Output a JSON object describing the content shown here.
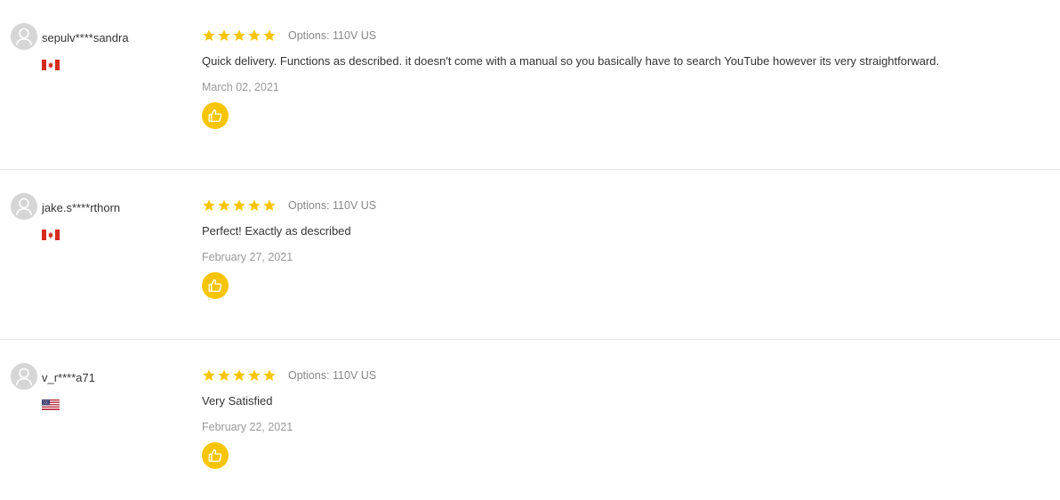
{
  "colors": {
    "star": "#f7c500",
    "like_button": "#f7c500",
    "avatar_bg": "#d6d6d6",
    "divider": "#e8e8e8",
    "meta_text": "#888888"
  },
  "icons": {
    "avatar": "default-user-icon",
    "star": "star-icon",
    "like": "thumbs-up-icon"
  },
  "reviews": [
    {
      "username": "sepulv****sandra",
      "country_flag": "canada-flag-icon",
      "rating_stars": 5,
      "options": "Options: 110V US",
      "comment": "Quick delivery. Functions as described. it doesn't come with a manual so you basically have to search YouTube however its very straightforward.",
      "date": "March 02, 2021"
    },
    {
      "username": "jake.s****rthorn",
      "country_flag": "canada-flag-icon",
      "rating_stars": 5,
      "options": "Options: 110V US",
      "comment": "Perfect! Exactly as described",
      "date": "February 27, 2021"
    },
    {
      "username": "v_r****a71",
      "country_flag": "usa-flag-icon",
      "rating_stars": 5,
      "options": "Options: 110V US",
      "comment": "Very Satisfied",
      "date": "February 22, 2021"
    }
  ]
}
